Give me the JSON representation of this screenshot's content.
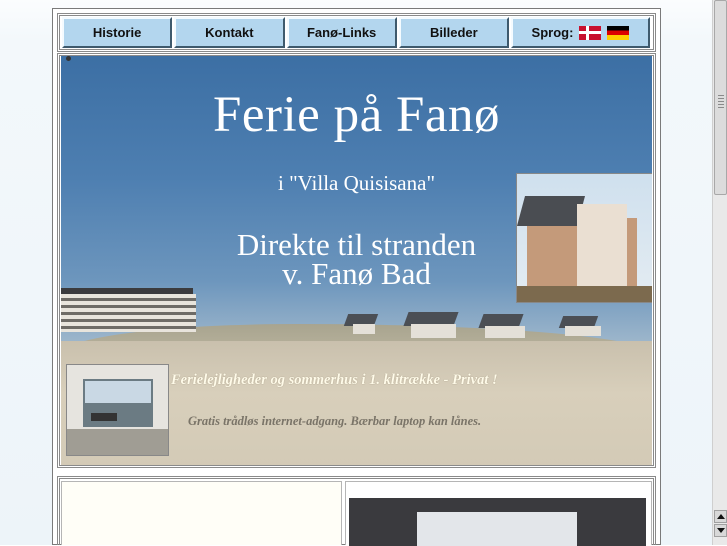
{
  "nav": {
    "items": [
      {
        "label": "Historie"
      },
      {
        "label": "Kontakt"
      },
      {
        "label": "Fanø-Links"
      },
      {
        "label": "Billeder"
      }
    ],
    "language_label": "Sprog:",
    "flags": [
      "danish-flag-icon",
      "german-flag-icon"
    ]
  },
  "hero": {
    "title": "Ferie på Fanø",
    "subtitle": "i \"Villa Quisisana\"",
    "tagline_line1": "Direkte til stranden",
    "tagline_line2": "v. Fanø Bad",
    "info_line1": "Ferielejligheder og sommerhus i 1. klitrække - Privat !",
    "info_line2": "Gratis trådløs internet-adgang. Bærbar laptop kan lånes."
  },
  "colors": {
    "nav_button": "#b3d6ee",
    "hero_sky": "#4e7fb1",
    "hero_sand": "#d8cfbb"
  }
}
